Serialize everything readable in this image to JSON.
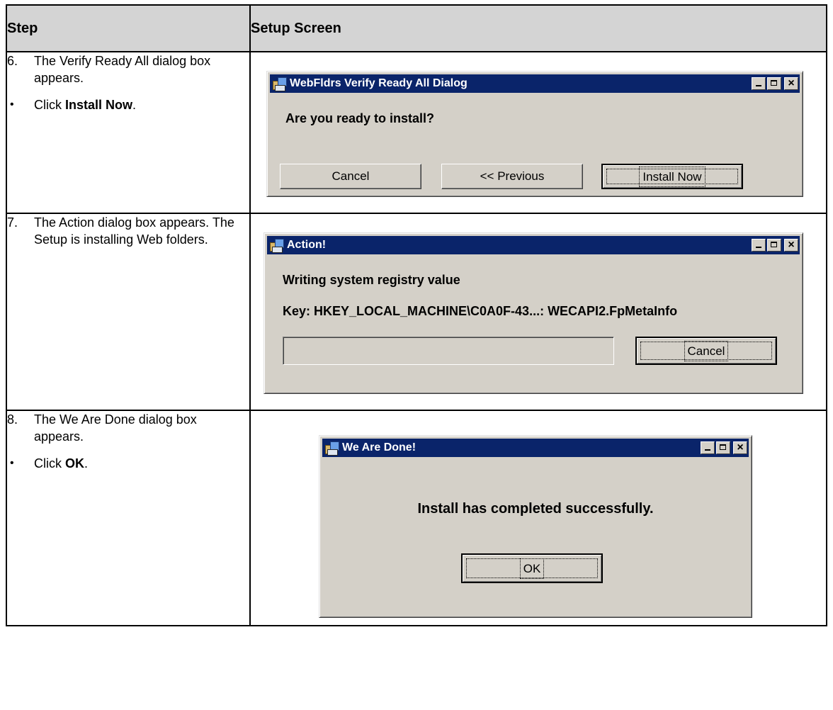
{
  "table": {
    "header": {
      "step": "Step",
      "screen": "Setup Screen"
    },
    "rows": [
      {
        "num": "6.",
        "text": "The Verify Ready All dialog box appears.",
        "bullet": "•",
        "action_prefix": "Click ",
        "action_bold": "Install Now",
        "action_suffix": ".",
        "dialog": {
          "title": "WebFldrs Verify Ready All Dialog",
          "message": "Are you ready to install?",
          "buttons": {
            "cancel": "Cancel",
            "previous": "<< Previous",
            "install": "Install Now"
          }
        }
      },
      {
        "num": "7.",
        "text": "The Action dialog box appears. The Setup is installing Web folders.",
        "dialog": {
          "title": "Action!",
          "message": "Writing system registry value",
          "key": "Key: HKEY_LOCAL_MACHINE\\C0A0F-43...: WECAPI2.FpMetaInfo",
          "buttons": {
            "cancel": "Cancel"
          },
          "progress": 0
        }
      },
      {
        "num": "8.",
        "text": "The We Are Done dialog box appears.",
        "bullet": "•",
        "action_prefix": "Click ",
        "action_bold": "OK",
        "action_suffix": ".",
        "dialog": {
          "title": "We Are Done!",
          "message": "Install has completed successfully.",
          "buttons": {
            "ok": "OK"
          }
        }
      }
    ]
  },
  "icons": {
    "app": "setup-app-icon",
    "minimize": "minimize-icon",
    "maximize": "maximize-icon",
    "close": "close-icon"
  },
  "colors": {
    "titlebar": "#0a246a",
    "dialog_bg": "#d4d0c8",
    "header_bg": "#d4d4d4"
  }
}
